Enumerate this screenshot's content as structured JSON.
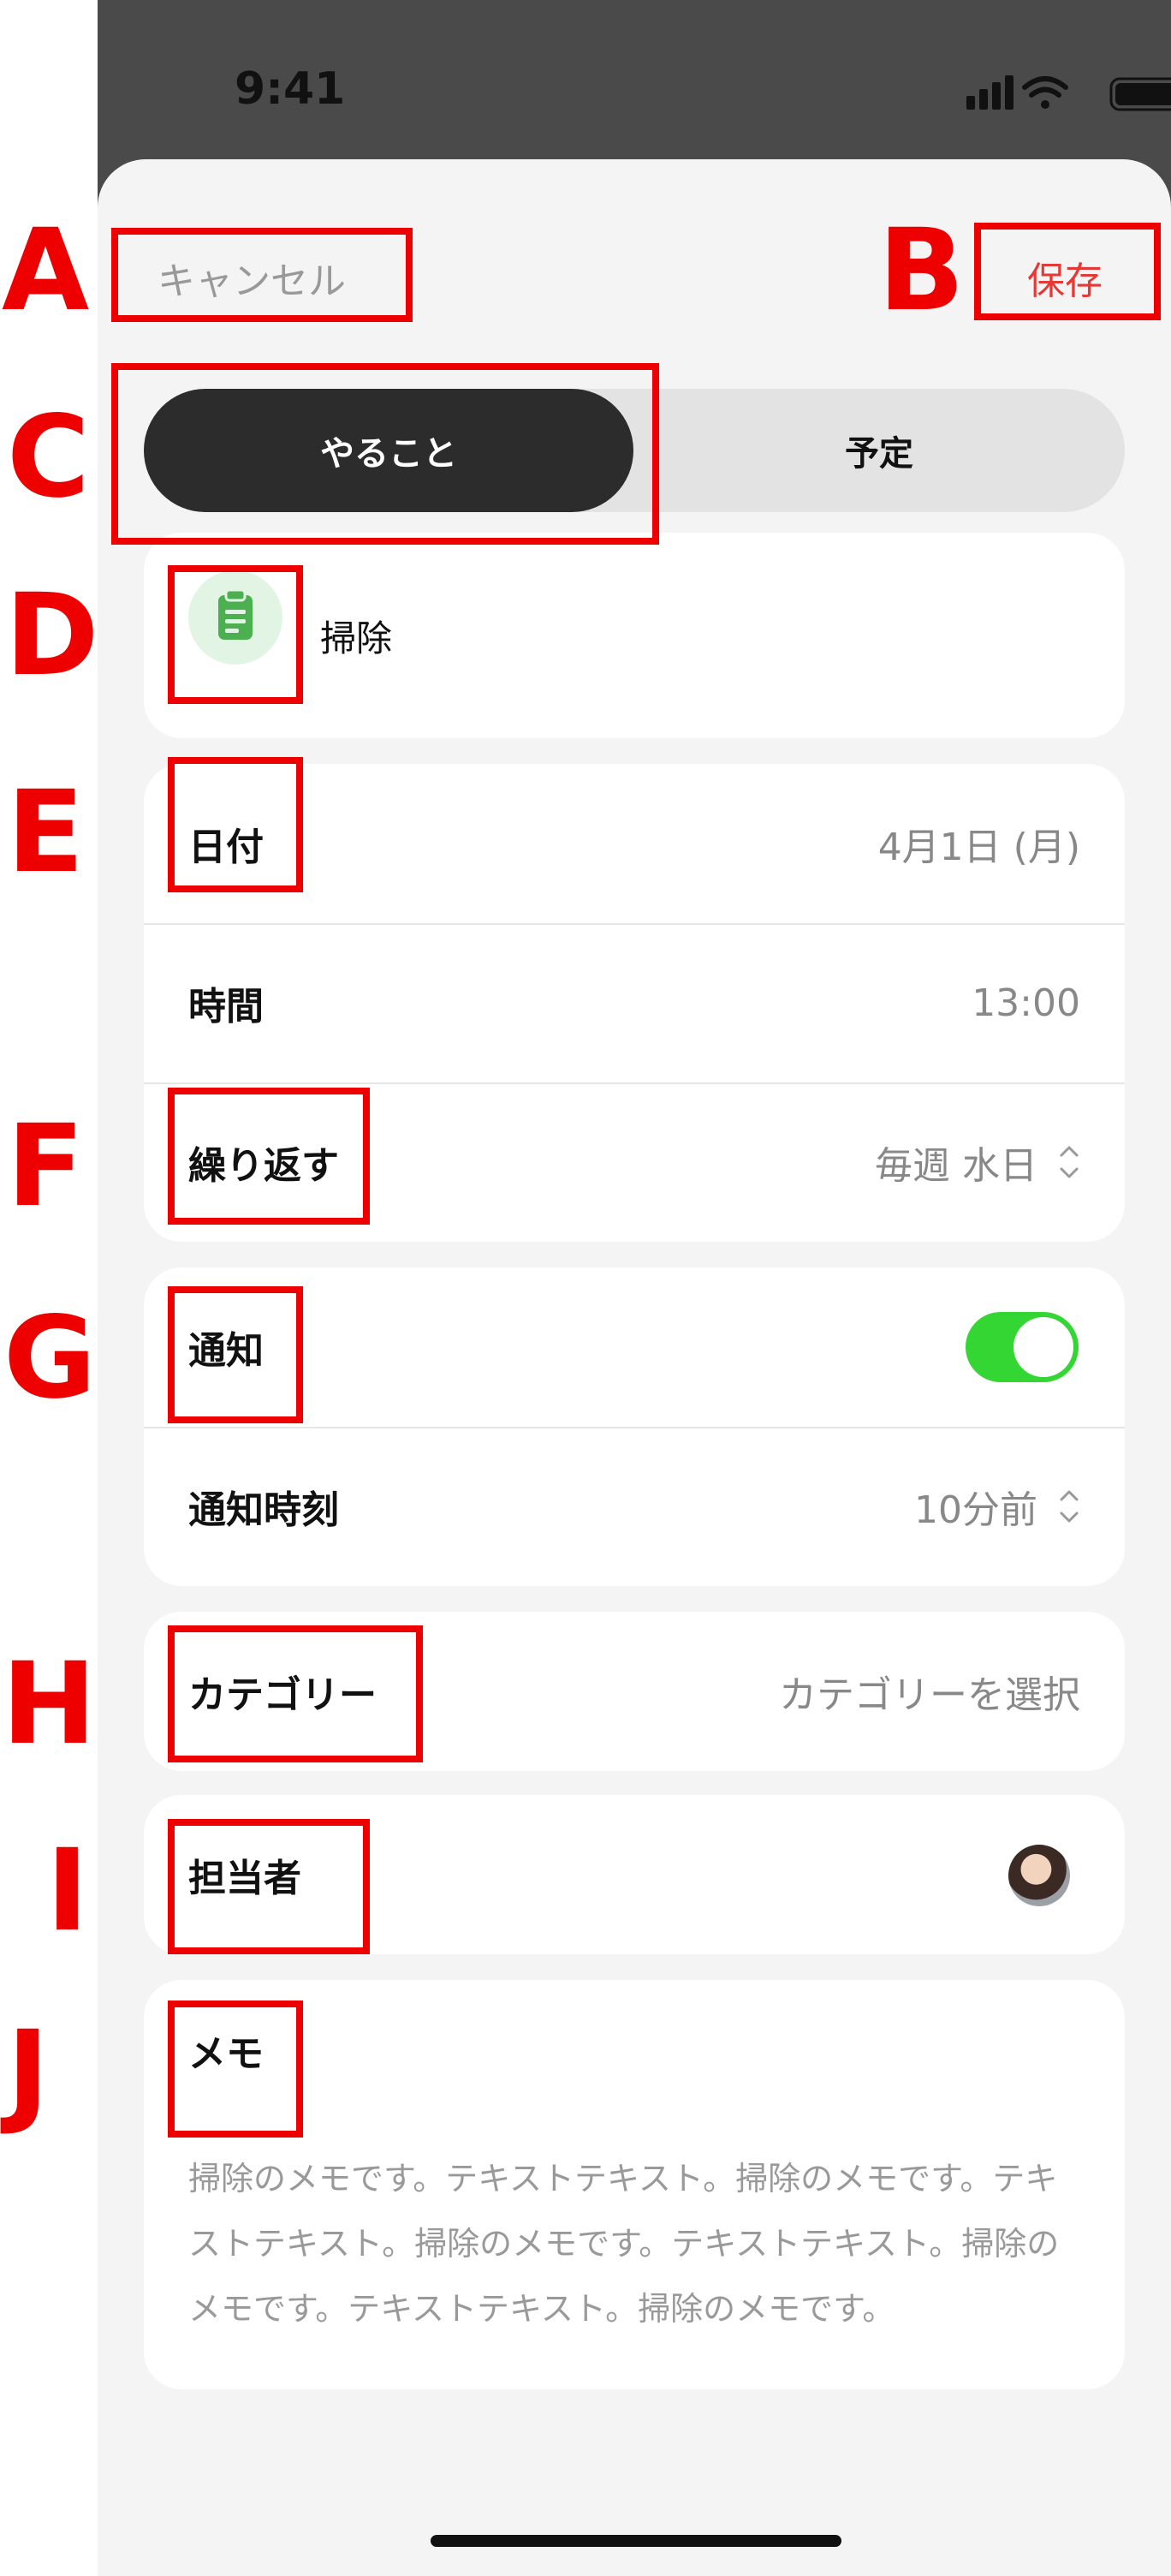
{
  "status_bar": {
    "time": "9:41",
    "icons": [
      "signal-icon",
      "wifi-icon",
      "battery-icon"
    ]
  },
  "nav": {
    "cancel_label": "キャンセル",
    "save_label": "保存",
    "save_color": "#e53935"
  },
  "segmented": {
    "options": [
      "やること",
      "予定"
    ],
    "selected": "やること"
  },
  "task": {
    "icon": "clipboard-icon",
    "icon_color": "#4caf50",
    "title": "掃除"
  },
  "schedule": {
    "date_label": "日付",
    "date_value": "4月1日 (月)",
    "time_label": "時間",
    "time_value": "13:00",
    "repeat_label": "繰り返す",
    "repeat_value": "毎週 水日"
  },
  "notification": {
    "label": "通知",
    "enabled": true,
    "toggle_color": "#33d633",
    "timing_label": "通知時刻",
    "timing_value": "10分前"
  },
  "category": {
    "label": "カテゴリー",
    "placeholder": "カテゴリーを選択"
  },
  "assignee": {
    "label": "担当者"
  },
  "memo": {
    "label": "メモ",
    "text": "掃除のメモです。テキストテキスト。掃除のメモです。テキストテキスト。掃除のメモです。テキストテキスト。掃除のメモです。テキストテキスト。掃除のメモです。"
  },
  "annotations": [
    "A",
    "B",
    "C",
    "D",
    "E",
    "F",
    "G",
    "H",
    "I",
    "J"
  ]
}
